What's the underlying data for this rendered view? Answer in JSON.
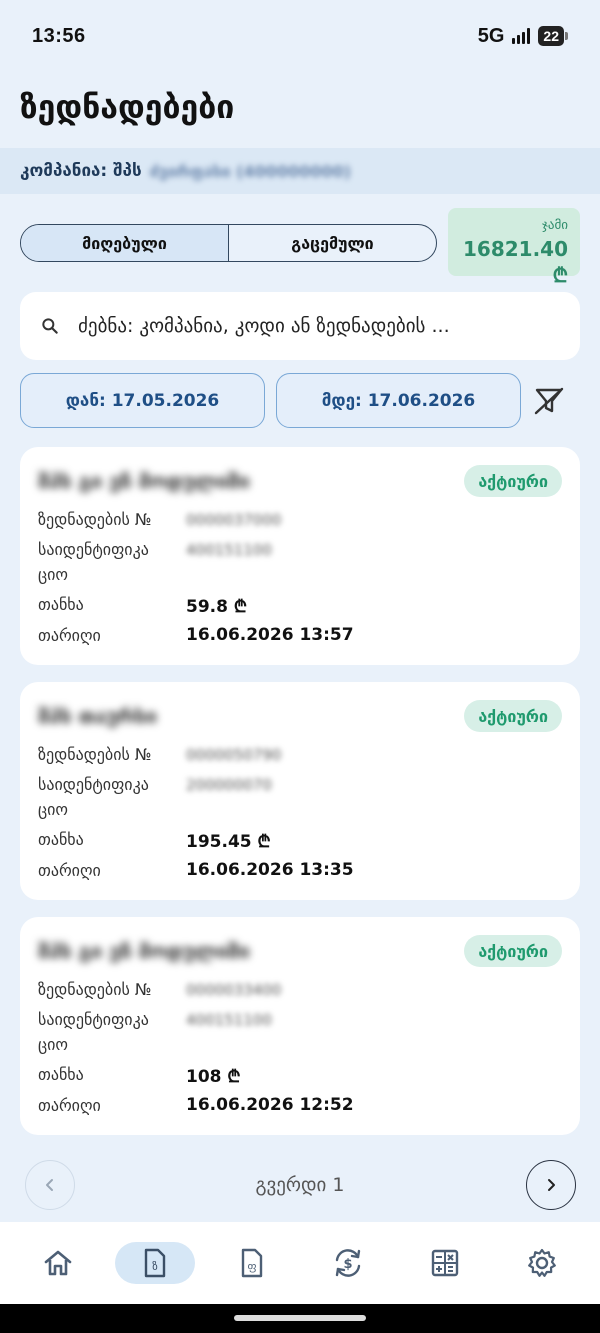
{
  "status_bar": {
    "time": "13:56",
    "network": "5G",
    "battery": "22"
  },
  "page": {
    "title": "ზედნადებები"
  },
  "company": {
    "label": "კომპანია: შპს",
    "value": "ძვირფასი (400000000)"
  },
  "tabs": [
    {
      "label": "მიღებული",
      "active": true
    },
    {
      "label": "გაცემული",
      "active": false
    }
  ],
  "total": {
    "label": "ჯამი",
    "value": "16821.40 ₾"
  },
  "search": {
    "placeholder": "ძებნა: კომპანია, კოდი ან ზედნადების ..."
  },
  "filters": {
    "from": "დან: 17.05.2026",
    "to": "მდე: 17.06.2026"
  },
  "labels": {
    "waybill_no": "ზედნადების №",
    "id_line1": "საიდენტიფიკა",
    "id_line2": "ციო",
    "amount": "თანხა",
    "date": "თარიღი"
  },
  "invoices": [
    {
      "company": "შპს გი ეჩ მოდულიში",
      "status": "აქტიური",
      "waybill": "0000037000",
      "id_code": "400151100",
      "amount": "59.8 ₾",
      "date": "16.06.2026 13:57"
    },
    {
      "company": "შპს თაურსი",
      "status": "აქტიური",
      "waybill": "0000050790",
      "id_code": "200000070",
      "amount": "195.45 ₾",
      "date": "16.06.2026 13:35"
    },
    {
      "company": "შპს გი ეჩ მოდულიში",
      "status": "აქტიური",
      "waybill": "0000033400",
      "id_code": "400151100",
      "amount": "108 ₾",
      "date": "16.06.2026 12:52"
    }
  ],
  "pagination": {
    "label": "გვერდი 1"
  },
  "nav": [
    "home-icon",
    "invoice-icon",
    "document-icon",
    "exchange-icon",
    "calculator-icon",
    "settings-icon"
  ],
  "colors": {
    "accent": "#1f4f86",
    "success": "#2d8b6a",
    "background": "#e9f1fa"
  }
}
